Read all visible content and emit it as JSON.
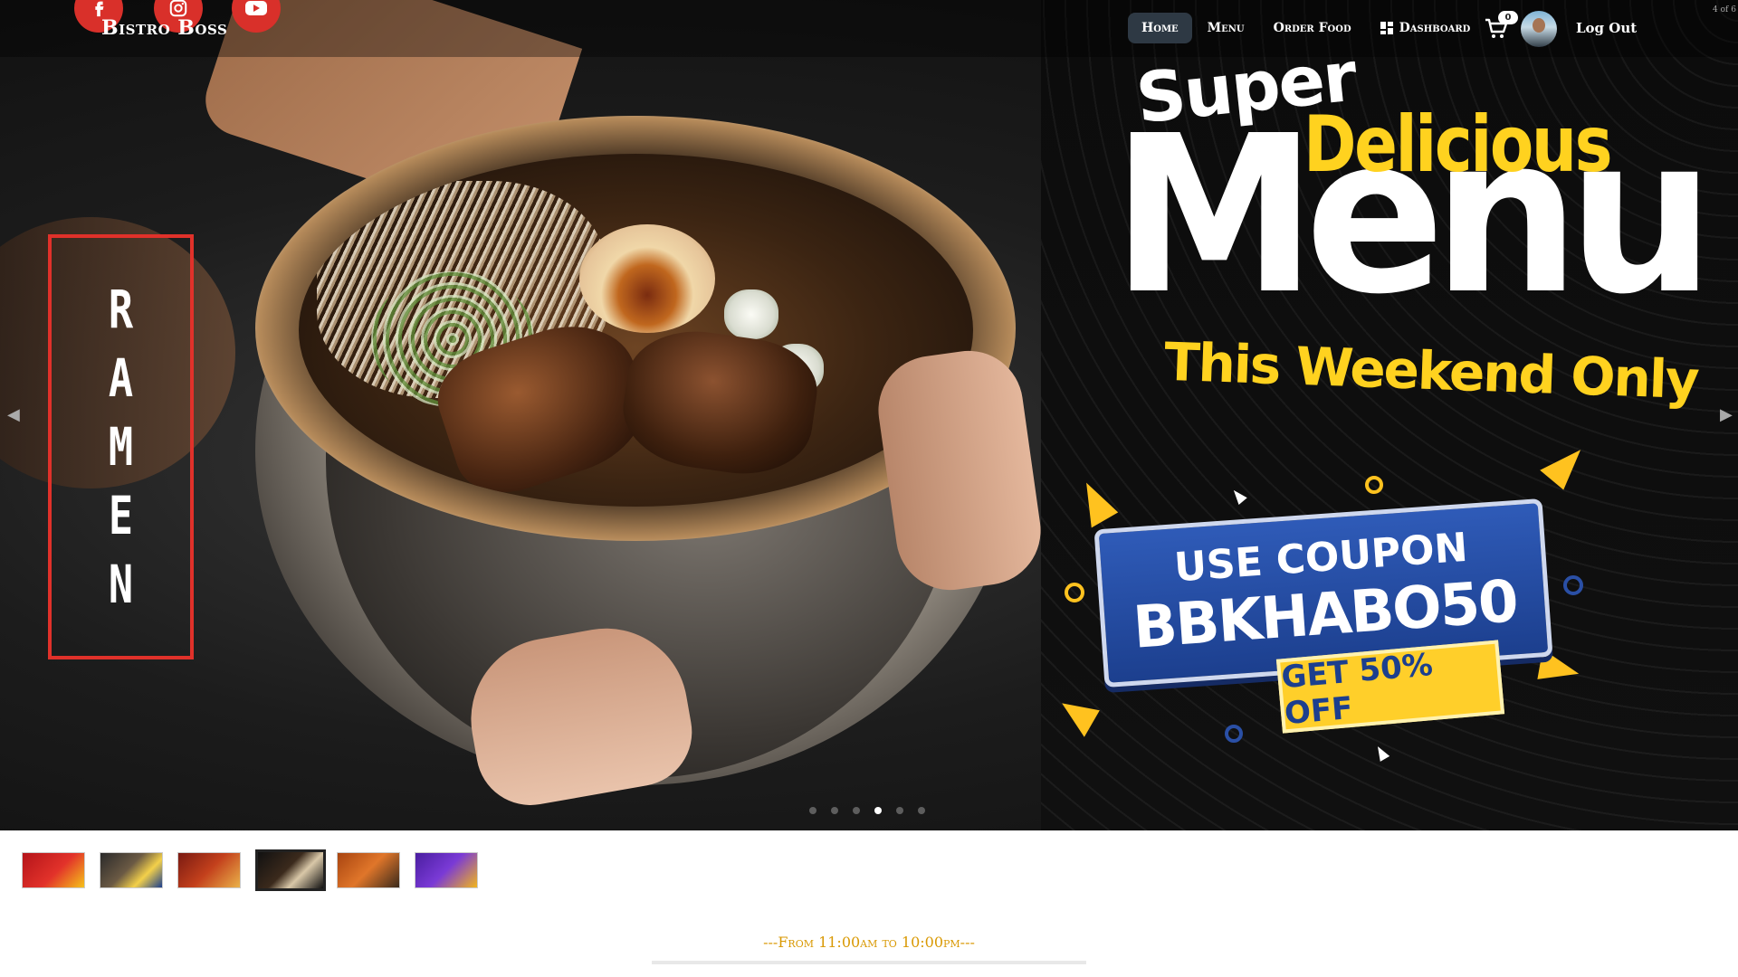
{
  "navbar": {
    "brand": "Bistro Boss",
    "social": [
      "facebook-icon",
      "instagram-icon",
      "youtube-icon"
    ],
    "links": [
      {
        "label": "Home",
        "active": true
      },
      {
        "label": "Menu"
      },
      {
        "label": "Order Food"
      },
      {
        "label": "Dashboard"
      }
    ],
    "cart_count": "0",
    "logout_label": "Log Out"
  },
  "carousel": {
    "counter": "4 of 6",
    "current_index": 4,
    "total": 6,
    "prev_icon": "chevron-left-icon",
    "next_icon": "chevron-right-icon"
  },
  "slide": {
    "side_label": "RAMEN",
    "side_letters": [
      "R",
      "A",
      "M",
      "E",
      "N"
    ],
    "promo_super": "Super",
    "promo_delicious": "Delicious",
    "promo_menu": "Menu",
    "promo_weekend": "This Weekend Only",
    "coupon_line1": "USE COUPON",
    "coupon_code": "BBKHABO50",
    "offer": "GET 50% OFF"
  },
  "hours": "---From 11:00am to 10:00pm---",
  "colors": {
    "accent_red": "#d9302a",
    "gold": "#d99904",
    "promo_yellow": "#ffd21f",
    "coupon_blue": "#2f5bb8",
    "nav_active": "#2e3944"
  }
}
